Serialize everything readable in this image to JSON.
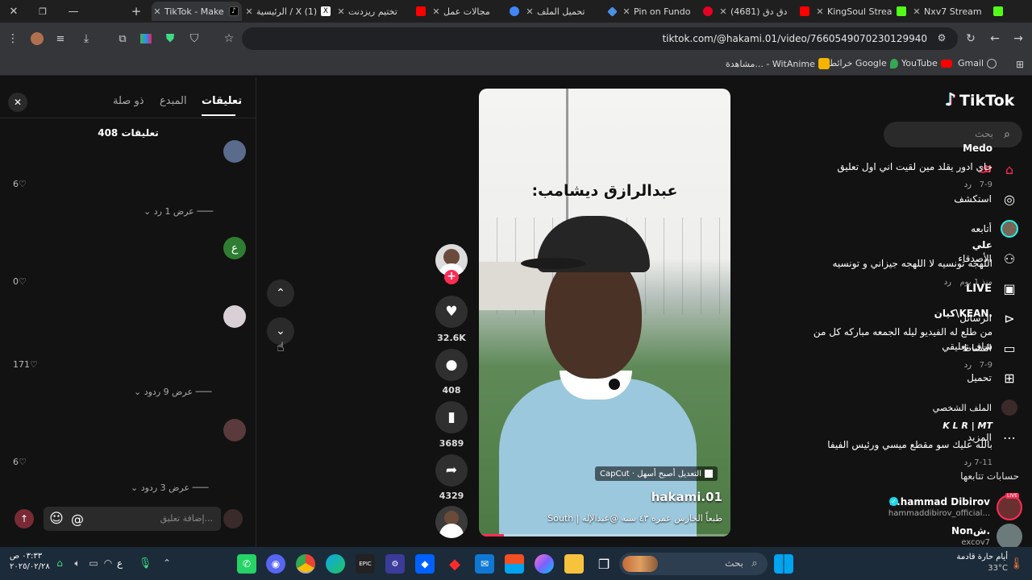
{
  "browser": {
    "tabs": [
      {
        "title": "TikTok - Make Your Day",
        "color": "#000000",
        "active": true
      },
      {
        "title": "الرئيسية / X (1)",
        "color": "#ffffff",
        "active": false
      },
      {
        "title": "تختيم ريزدنت",
        "color": "#ff0000",
        "active": false
      },
      {
        "title": "مجالات عمل",
        "color": "#4285f4",
        "active": false
      },
      {
        "title": "تحميل الملف",
        "color": "#4a90e2",
        "active": false
      },
      {
        "title": "Pin on Fundo",
        "color": "#e60023",
        "active": false
      },
      {
        "title": "(4681) دق دق",
        "color": "#ff0000",
        "active": false
      },
      {
        "title": "KingSoul Strea",
        "color": "#53fc18",
        "active": false
      },
      {
        "title": "Nxv7 Stream",
        "color": "#53fc18",
        "active": false
      }
    ],
    "url": "tiktok.com/@hakami.01/video/7660549070230129940",
    "bookmarks": [
      {
        "label": "Gmail",
        "color": "#ea4335"
      },
      {
        "label": "YouTube",
        "color": "#ff0000"
      },
      {
        "label": "خرائط Google",
        "color": "#34a853"
      },
      {
        "label": "مشاهدة... - WitAnime",
        "color": "#f4b400"
      }
    ]
  },
  "tiktok": {
    "logo": "TikTok",
    "search_placeholder": "بحث",
    "nav": [
      {
        "label": "لك",
        "icon": "home-icon",
        "color": "#fe2c55"
      },
      {
        "label": "استكشف",
        "icon": "compass-icon"
      },
      {
        "label": "أتابعه",
        "icon": "avatar-icon"
      },
      {
        "label": "الأصدقاء",
        "icon": "friends-icon"
      },
      {
        "label": "LIVE",
        "icon": "live-icon"
      },
      {
        "label": "الرسائل",
        "icon": "messages-icon"
      },
      {
        "label": "النشاط",
        "icon": "activity-icon"
      },
      {
        "label": "تحميل",
        "icon": "upload-icon"
      },
      {
        "label": "الملف الشخصي",
        "icon": "profile-icon"
      },
      {
        "label": "المزيد",
        "icon": "more-icon"
      }
    ],
    "following_title": "حسابات تتابعها",
    "following": [
      {
        "name": "...hammad Dibirov",
        "handle": "hammaddibirov_official...",
        "badge": "LIVE"
      },
      {
        "name": "Nonش.",
        "handle": "excov7"
      }
    ]
  },
  "video": {
    "overlay_title": "عبدالرازق ديشامب:",
    "capcut_label": "CapCut · التعديل أصبح أسهل",
    "author": "hakami.01",
    "caption": "طبعاً الحارس عمره ٤٣ سنه @عبدالإله | South",
    "actions": {
      "likes": "32.6K",
      "comments": "408",
      "saves": "3689",
      "shares": "4329"
    }
  },
  "comments": {
    "tabs": [
      "تعليقات",
      "المبدع",
      "ذو صلة"
    ],
    "count_label": "408 تعليقات",
    "input_placeholder": "إضافة تعليق...",
    "items": [
      {
        "name": "Medo",
        "text": "جاي ادور يقلد مين لقيت اني اول تعليق",
        "date": "7-9",
        "reply": "رد",
        "likes": "6",
        "more": "عرض 1 رد"
      },
      {
        "name": "علي",
        "text": "اللهجه تونسيه لا اللهجه جيزاني و تونسيه",
        "date": "منذ 1 يوم",
        "reply": "رد",
        "likes": "0",
        "avatar_letter": "ع"
      },
      {
        "name": "كيان\\KEAN.",
        "text": "من طلع له الفيديو ليله الجمعه مباركه كل من شاف تعليقي",
        "date": "7-9",
        "reply": "رد",
        "likes": "171",
        "more": "عرض 9 ردود"
      },
      {
        "name": "K L R | MT",
        "text": "بالله عليك سو مقطع ميسي ورئيس الفيفا",
        "date": "7-11",
        "reply": "رد",
        "likes": "6",
        "more": "عرض 3 ردود"
      }
    ]
  },
  "taskbar": {
    "search_placeholder": "بحث",
    "weather_text": "أيام حارة قادمة",
    "temperature": "33°C",
    "time": "٠٣:٣٣ ص",
    "date": "٢٠٢٥/٠٢/٢٨",
    "lang": "ع"
  }
}
